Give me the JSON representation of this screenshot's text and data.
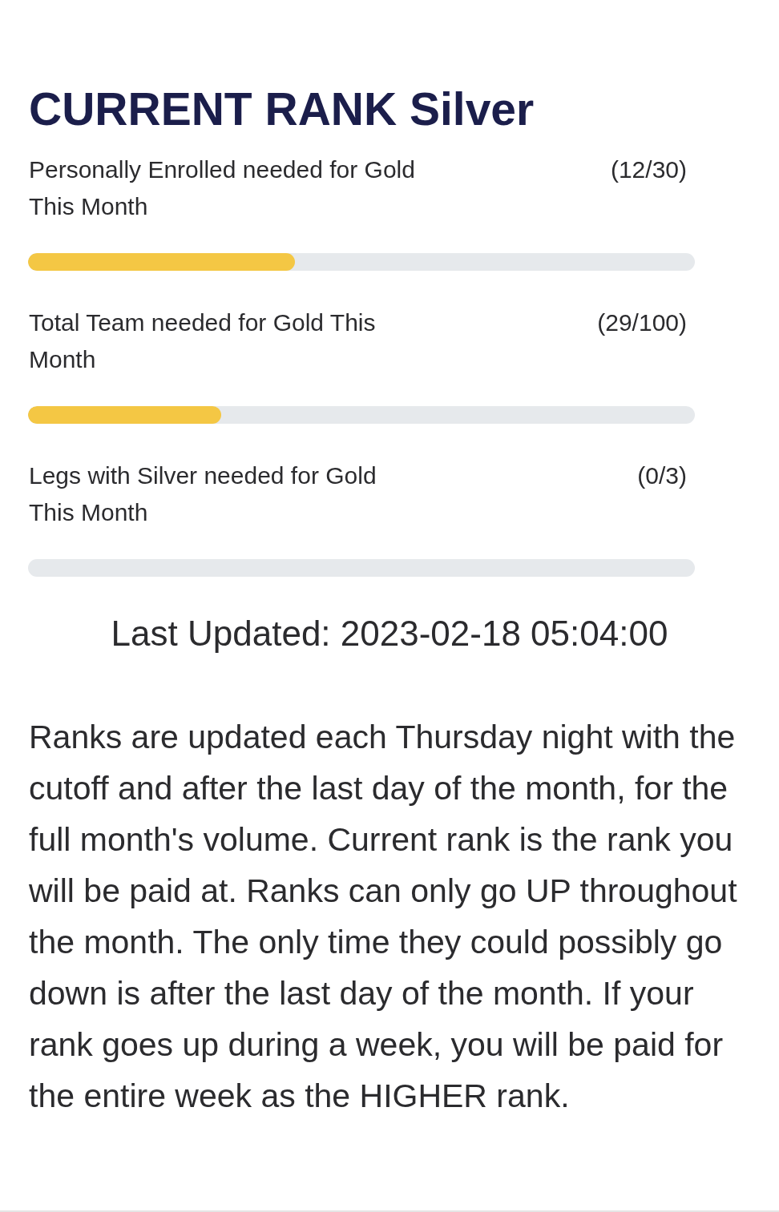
{
  "title": "CURRENT RANK Silver",
  "requirements": [
    {
      "label": "Personally Enrolled needed for Gold This Month",
      "count": "(12/30)",
      "level": 0.4
    },
    {
      "label": "Total Team needed for Gold This Month",
      "count": "(29/100)",
      "level": 0.29
    },
    {
      "label": "Legs with Silver needed for Gold This Month",
      "count": "(0/3)"
    }
  ],
  "last_updated": "Last Updated: 2023-02-18 05:04:00",
  "note": "Ranks are updated each Thursday night with the cutoff and after the last day of the month, for the full month's volume. Current rank is the rank you will be paid at. Ranks can only go UP throughout the month. The only time they could possibly go down is after the last day of the month. If your rank goes up during a week, you will be paid for the entire week as the HIGHER rank."
}
